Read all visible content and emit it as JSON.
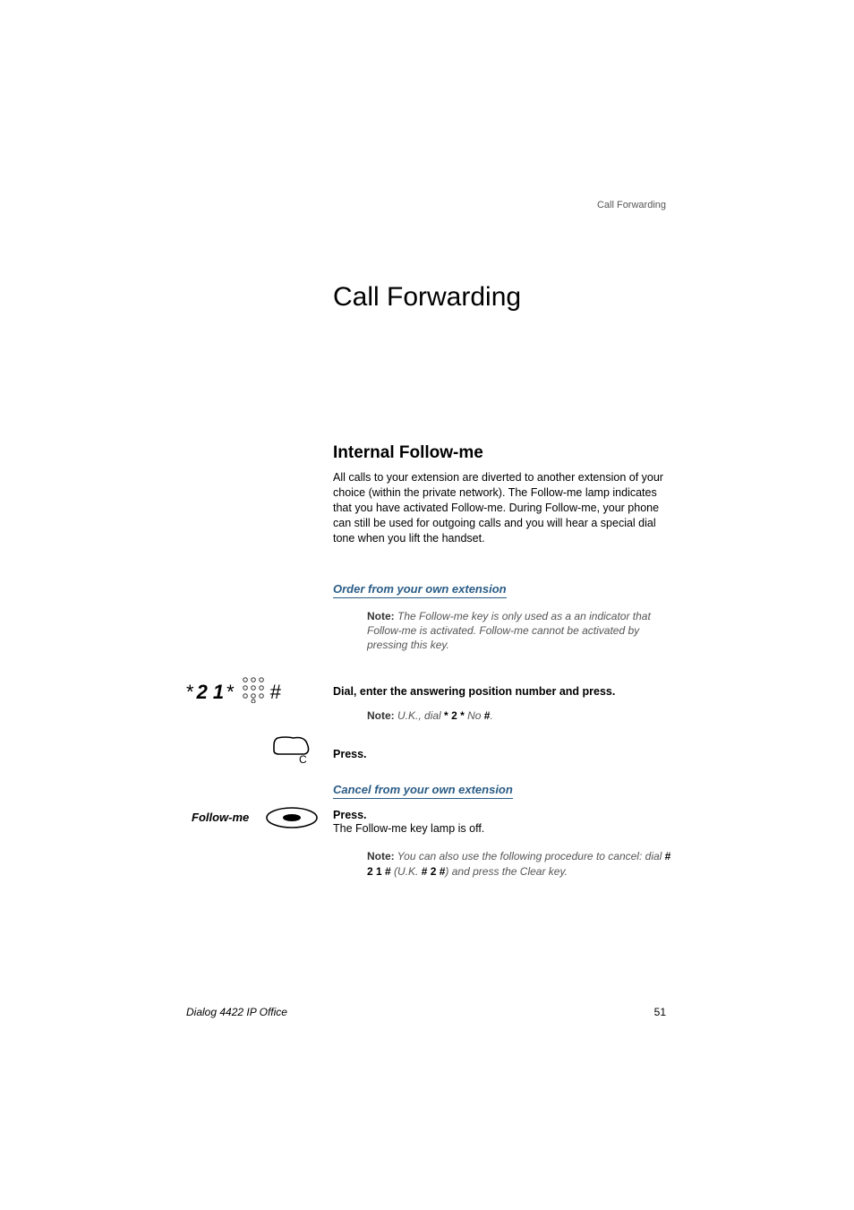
{
  "running_header": "Call Forwarding",
  "title": "Call Forwarding",
  "section_title": "Internal Follow-me",
  "intro": "All calls to your extension are diverted to another extension of your choice (within the private network). The Follow-me lamp indicates that you have activated Follow-me. During Follow-me, your phone can still be used for outgoing calls and you will hear a special dial tone when you lift the handset.",
  "order": {
    "heading": "Order from your own extension",
    "note_label": "Note:",
    "note_text": "The Follow-me key is only used as a an indicator that Follow-me is activated. Follow-me cannot be activated by pressing this key.",
    "dial_star1": "*",
    "dial_digits": "2 1",
    "dial_star2": "*",
    "dial_hash": "#",
    "dial_instruction": "Dial, enter the answering position number and press.",
    "uk_note_label": "Note:",
    "uk_prefix": "U.K., dial ",
    "uk_star1": "*",
    "uk_digits": "2",
    "uk_star2": "*",
    "uk_no": " No ",
    "uk_hash": "#",
    "uk_suffix": ".",
    "press": "Press."
  },
  "cancel": {
    "heading": "Cancel from your own extension",
    "followme_label": "Follow-me",
    "press": "Press.",
    "lamp_off": "The Follow-me key lamp is off.",
    "note_label": "Note:",
    "note_prefix": "You can also use the following procedure to cancel: dial ",
    "seq1": "# 2 1 #",
    "mid": " (U.K. ",
    "seq2": "# 2 #",
    "suffix": ") and press the Clear key."
  },
  "footer": {
    "product": "Dialog 4422 IP Office",
    "page": "51"
  }
}
